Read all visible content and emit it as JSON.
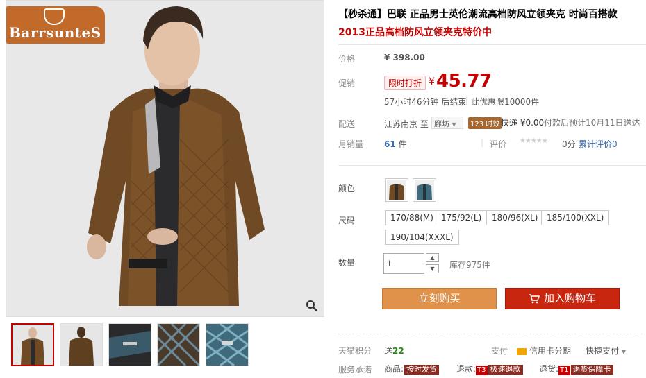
{
  "brand": {
    "logo_text": "BarrsunteS"
  },
  "product": {
    "title": "【秒杀通】巴联 正品男士英伦潮流高档防风立领夹克 时尚百搭款",
    "subtitle": "2013正品高档防风立领夹克特价中"
  },
  "price": {
    "label": "价格",
    "original": "¥ 398.00",
    "promo_label": "促销",
    "promo_tag": "限时打折",
    "currency": "¥",
    "value": "45.77",
    "countdown": "57小时46分钟 后结束",
    "limit": "此优惠限10000件"
  },
  "delivery": {
    "label": "配送",
    "from": "江苏南京 至",
    "to_city": "廊坊",
    "badge": "123 时效",
    "express": "快递 ¥0.00",
    "note": "付款后预计10月11日送达"
  },
  "sales": {
    "label": "月销量",
    "count": "61",
    "unit": "件",
    "rating_label": "评价",
    "stars": "★★★★★",
    "score": "0分",
    "review_link": "累计评价0"
  },
  "options": {
    "color_label": "颜色",
    "size_label": "尺码",
    "sizes": [
      "170/88(M)",
      "175/92(L)",
      "180/96(XL)",
      "185/100(XXL)",
      "190/104(XXXL)"
    ],
    "qty_label": "数量",
    "qty_value": "1",
    "stock": "库存975件"
  },
  "actions": {
    "buy_now": "立刻购买",
    "add_cart": "加入购物车"
  },
  "footer": {
    "points_label": "天猫积分",
    "points_prefix": "送",
    "points_value": "22",
    "pay_label": "支付",
    "credit": "信用卡分期",
    "quick_pay": "快捷支付",
    "service_label": "服务承诺",
    "ship_prefix": "商品:",
    "ship_tag": "按时发货",
    "refund_prefix": "退款:",
    "refund_code": "T3",
    "refund_tag": "极速退款",
    "return_prefix": "退货:",
    "return_code": "T1",
    "return_tag": "退货保障卡"
  },
  "colors": {
    "accent": "#c40000",
    "buy": "#e0924a",
    "cart": "#c8260f",
    "logo": "#c26a2a"
  }
}
